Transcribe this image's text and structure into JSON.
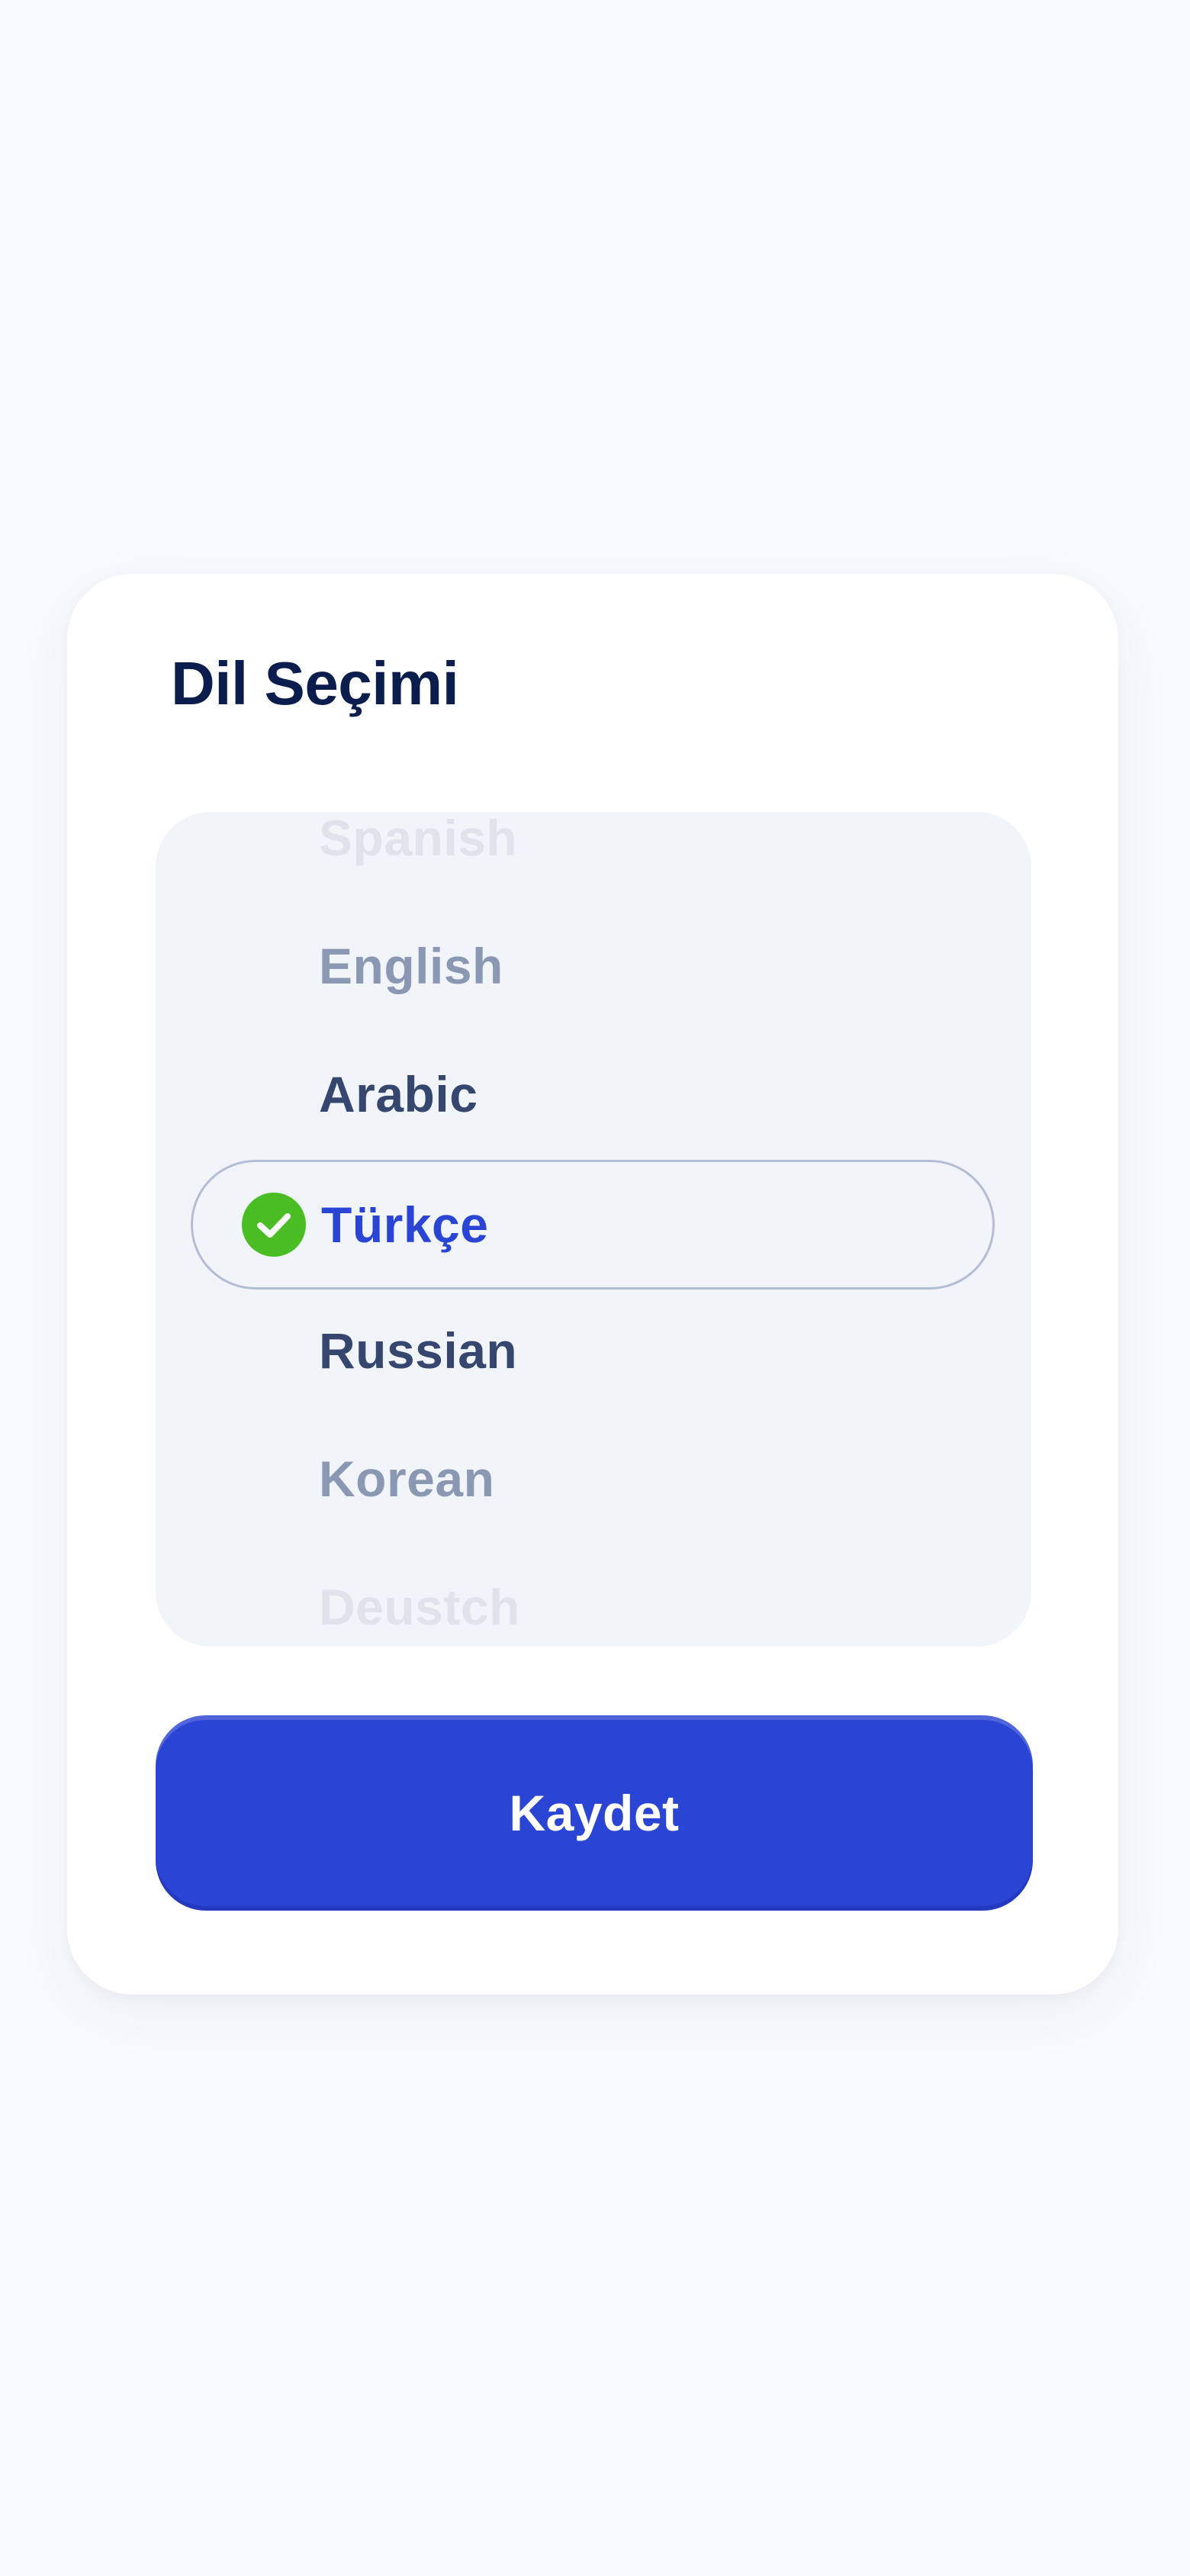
{
  "dialog": {
    "title": "Dil Seçimi"
  },
  "language_picker": {
    "items": [
      {
        "label": "Spanish"
      },
      {
        "label": "English"
      },
      {
        "label": "Arabic"
      },
      {
        "label": "Türkçe"
      },
      {
        "label": "Russian"
      },
      {
        "label": "Korean"
      },
      {
        "label": "Deustch"
      }
    ],
    "selected_label": "Türkçe",
    "selected_icon": "check-circle-icon"
  },
  "actions": {
    "save_label": "Kaydet"
  },
  "colors": {
    "accent": "#2a44d4",
    "check": "#4bbd24",
    "title": "#0b1d4d",
    "background": "#f9fafd"
  }
}
